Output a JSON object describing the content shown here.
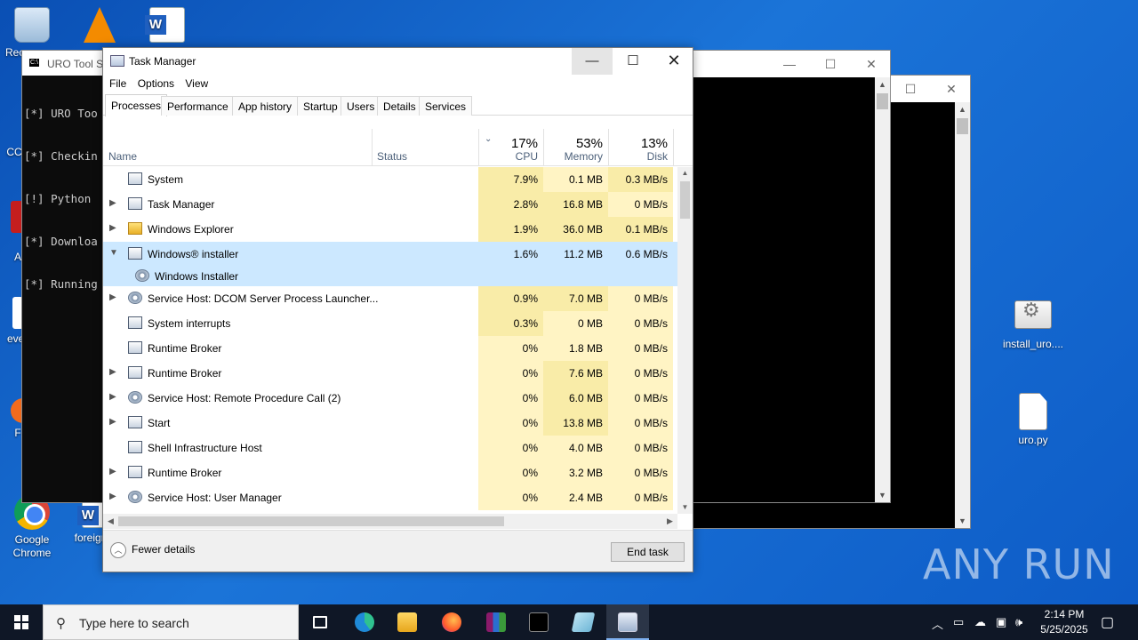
{
  "desktop": {
    "icons": [
      {
        "label": "Rec",
        "kind": "recycle"
      },
      {
        "label": "",
        "kind": "vlc"
      },
      {
        "label": "",
        "kind": "word"
      },
      {
        "label": "CC",
        "kind": "other"
      },
      {
        "label": "A",
        "kind": "other"
      },
      {
        "label": "eve",
        "kind": "other"
      },
      {
        "label": "F",
        "kind": "other"
      },
      {
        "label": "Google Chrome",
        "kind": "chrome"
      },
      {
        "label": "foreign",
        "kind": "word"
      },
      {
        "label": "install_uro....",
        "kind": "config-file"
      },
      {
        "label": "uro.py",
        "kind": "python-file"
      }
    ]
  },
  "console": {
    "title": "URO Tool S",
    "lines": [
      "[*] URO Too",
      "[*] Checkin",
      "[!] Python ",
      "[*] Downloa",
      "[*] Running"
    ]
  },
  "task_manager": {
    "title": "Task Manager",
    "menu": [
      "File",
      "Options",
      "View"
    ],
    "tabs": [
      "Processes",
      "Performance",
      "App history",
      "Startup",
      "Users",
      "Details",
      "Services"
    ],
    "active_tab": "Processes",
    "columns": {
      "name": "Name",
      "status": "Status",
      "cpu": {
        "pct": "17%",
        "label": "CPU"
      },
      "memory": {
        "pct": "53%",
        "label": "Memory"
      },
      "disk": {
        "pct": "13%",
        "label": "Disk"
      }
    },
    "processes": [
      {
        "name": "System",
        "expandable": false,
        "icon": "window-icon",
        "cpu": "7.9%",
        "mem": "0.1 MB",
        "disk": "0.3 MB/s"
      },
      {
        "name": "Task Manager",
        "expandable": true,
        "icon": "task-manager-icon",
        "cpu": "2.8%",
        "mem": "16.8 MB",
        "disk": "0 MB/s"
      },
      {
        "name": "Windows Explorer",
        "expandable": true,
        "icon": "folder-icon",
        "cpu": "1.9%",
        "mem": "36.0 MB",
        "disk": "0.1 MB/s"
      },
      {
        "name": "Windows® installer",
        "expandable": true,
        "expanded": true,
        "selected": true,
        "icon": "installer-icon",
        "cpu": "1.6%",
        "mem": "11.2 MB",
        "disk": "0.6 MB/s"
      },
      {
        "name": "Windows Installer",
        "child": true,
        "selected": true,
        "icon": "gear-icon",
        "cpu": "",
        "mem": "",
        "disk": ""
      },
      {
        "name": "Service Host: DCOM Server Process Launcher...",
        "expandable": true,
        "icon": "gear-icon",
        "cpu": "0.9%",
        "mem": "7.0 MB",
        "disk": "0 MB/s"
      },
      {
        "name": "System interrupts",
        "expandable": false,
        "icon": "window-icon",
        "cpu": "0.3%",
        "mem": "0 MB",
        "disk": "0 MB/s"
      },
      {
        "name": "Runtime Broker",
        "expandable": false,
        "icon": "window-icon",
        "cpu": "0%",
        "mem": "1.8 MB",
        "disk": "0 MB/s"
      },
      {
        "name": "Runtime Broker",
        "expandable": true,
        "icon": "window-icon",
        "cpu": "0%",
        "mem": "7.6 MB",
        "disk": "0 MB/s"
      },
      {
        "name": "Service Host: Remote Procedure Call (2)",
        "expandable": true,
        "icon": "gear-icon",
        "cpu": "0%",
        "mem": "6.0 MB",
        "disk": "0 MB/s"
      },
      {
        "name": "Start",
        "expandable": true,
        "icon": "window-icon",
        "cpu": "0%",
        "mem": "13.8 MB",
        "disk": "0 MB/s"
      },
      {
        "name": "Shell Infrastructure Host",
        "expandable": false,
        "icon": "window-icon",
        "cpu": "0%",
        "mem": "4.0 MB",
        "disk": "0 MB/s"
      },
      {
        "name": "Runtime Broker",
        "expandable": true,
        "icon": "window-icon",
        "cpu": "0%",
        "mem": "3.2 MB",
        "disk": "0 MB/s"
      },
      {
        "name": "Service Host: User Manager",
        "expandable": true,
        "icon": "gear-icon",
        "cpu": "0%",
        "mem": "2.4 MB",
        "disk": "0 MB/s"
      }
    ],
    "footer": {
      "fewer_details": "Fewer details",
      "end_task": "End task"
    }
  },
  "taskbar": {
    "search_placeholder": "Type here to search",
    "apps": [
      "task-view-icon",
      "edge-icon",
      "file-explorer-icon",
      "firefox-icon",
      "winrar-icon",
      "terminal-icon",
      "notepad-icon",
      "task-manager-icon"
    ],
    "clock": {
      "time": "2:14 PM",
      "date": "5/25/2025"
    }
  },
  "watermark": "ANY RUN",
  "colors": {
    "desktop": "#1565c8",
    "selected_row": "#cce8ff",
    "cpu_highlight": "#fff4c4",
    "taskbar": "#0f1726"
  }
}
